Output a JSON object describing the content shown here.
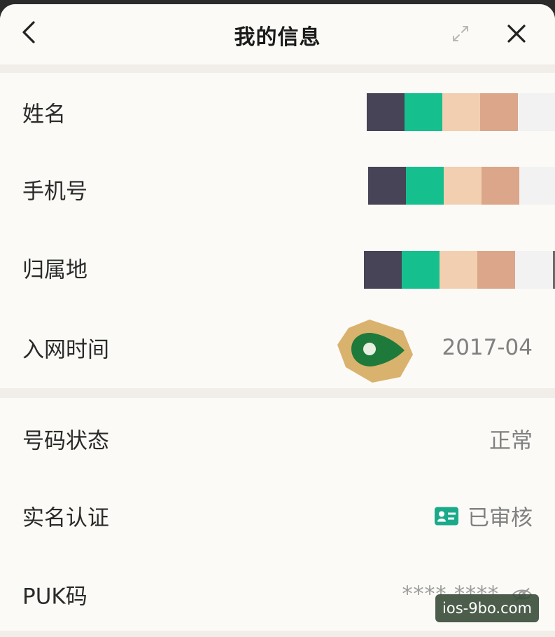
{
  "header": {
    "title": "我的信息",
    "back_icon": "chevron-left-icon",
    "expand_icon": "expand-icon",
    "close_icon": "close-icon"
  },
  "rows": {
    "name": {
      "label": "姓名"
    },
    "phone": {
      "label": "手机号"
    },
    "location": {
      "label": "归属地"
    },
    "join_date": {
      "label": "入网时间",
      "value": "2017-04"
    },
    "status": {
      "label": "号码状态",
      "value": "正常"
    },
    "verification": {
      "label": "实名认证",
      "value": "已审核",
      "icon": "id-card-icon"
    },
    "puk": {
      "label": "PUK码",
      "value": "**** ****",
      "icon": "eye-hidden-icon"
    }
  },
  "mosaic_colors": [
    "#474457",
    "#16c08e",
    "#f2cfb0",
    "#dba68a",
    "#f2f2f2",
    "#6a6a6a"
  ],
  "accent_color": "#1aaa8a",
  "watermark": "ios-9bo.com"
}
